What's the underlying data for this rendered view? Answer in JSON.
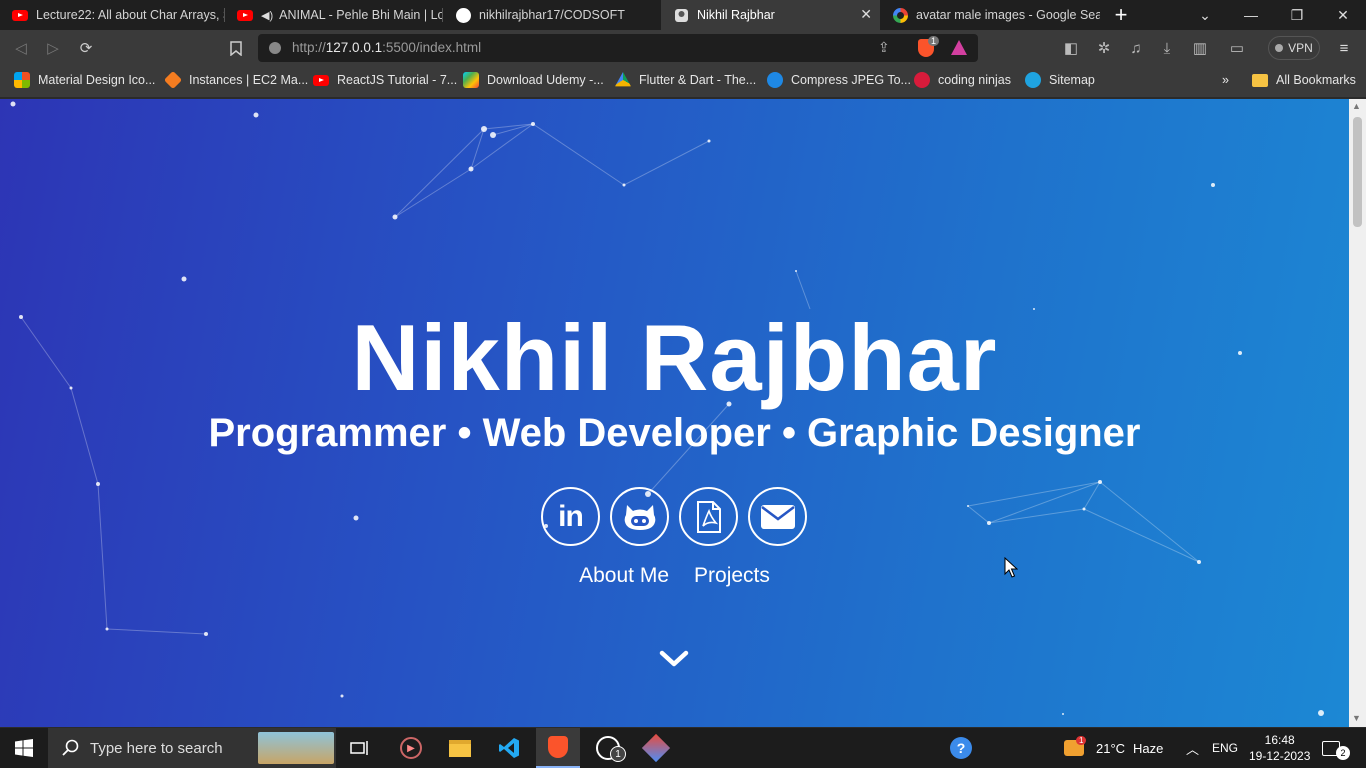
{
  "browser": {
    "tabs": [
      {
        "title": "Lecture22: All about Char Arrays, S",
        "icon": "youtube-icon"
      },
      {
        "title": "ANIMAL - Pehle Bhi Main | Loo",
        "icon": "youtube-icon"
      },
      {
        "title": "nikhilrajbhar17/CODSOFT",
        "icon": "github-icon"
      },
      {
        "title": "Nikhil Rajbhar",
        "icon": "portfolio-icon",
        "active": true
      },
      {
        "title": "avatar male images - Google Sear",
        "icon": "google-icon"
      }
    ],
    "url_prefix": "http://",
    "url_host": "127.0.0.1",
    "url_path": ":5500/index.html",
    "brave_shield_count": "1",
    "vpn_label": "VPN",
    "bookmarks": [
      "Material Design Ico...",
      "Instances | EC2 Ma...",
      "ReactJS Tutorial - 7...",
      "Download Udemy -...",
      "Flutter & Dart - The...",
      "Compress JPEG To...",
      "coding ninjas",
      "Sitemap"
    ],
    "all_bookmarks": "All Bookmarks",
    "more_bookmarks": "»"
  },
  "page": {
    "name": "Nikhil Rajbhar",
    "tagline": "Programmer • Web Developer • Graphic Designer",
    "socials": [
      "linkedin-icon",
      "github-icon",
      "pdf-resume-icon",
      "email-icon"
    ],
    "links": {
      "about": "About Me",
      "projects": "Projects"
    }
  },
  "taskbar": {
    "search_placeholder": "Type here to search",
    "whatsapp_badge": "1",
    "weather_badge": "1",
    "temperature": "21°C",
    "weather": "Haze",
    "language": "ENG",
    "time": "16:48",
    "date": "19-12-2023",
    "notifications": "2"
  },
  "colors": {
    "gradient_start": "#2d35b5",
    "gradient_end": "#1c88d4",
    "tab_active": "#3a3a3a"
  }
}
